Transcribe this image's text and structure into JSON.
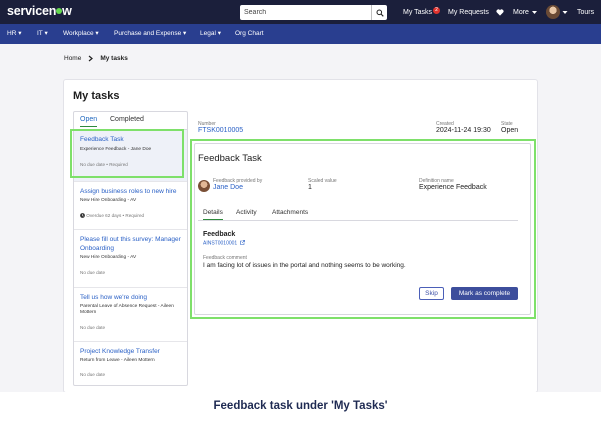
{
  "header": {
    "logo": "servicenow",
    "search_placeholder": "Search",
    "nav": [
      {
        "label": "My Tasks",
        "badge": "2"
      },
      {
        "label": "My Requests"
      },
      {
        "label": "More"
      },
      {
        "label": "Tours"
      }
    ]
  },
  "menubar": {
    "items": [
      "HR",
      "IT",
      "Workplace",
      "Purchase and Expense",
      "Legal",
      "Org Chart"
    ]
  },
  "breadcrumb": {
    "home": "Home",
    "current": "My tasks"
  },
  "page": {
    "title": "My tasks",
    "list_tabs": [
      "Open",
      "Completed"
    ]
  },
  "tasks": [
    {
      "title": "Feedback Task",
      "subtitle": "Experience Feedback - Jane Doe",
      "meta": "No due date • Required"
    },
    {
      "title": "Assign business roles to new hire",
      "subtitle": "New Hire Onboarding - AV",
      "meta": "Overdue 62 days • Required"
    },
    {
      "title": "Please fill out this survey: Manager Onboarding",
      "subtitle": "New Hire Onboarding - AV",
      "meta": "No due date"
    },
    {
      "title": "Tell us how we're doing",
      "subtitle": "Parental Leave of Absence Request - Aileen Mottern",
      "meta": "No due date"
    },
    {
      "title": "Project Knowledge Transfer",
      "subtitle": "Return from Leave - Aileen Mottern",
      "meta": "No due date"
    }
  ],
  "record": {
    "number_label": "Number",
    "number": "FTSK0010005",
    "created_label": "Created",
    "created": "2024-11-24 19:30",
    "state_label": "State",
    "state": "Open"
  },
  "detail": {
    "title": "Feedback Task",
    "provided_by_label": "Feedback provided by",
    "provided_by": "Jane Doe",
    "scaled_label": "Scaled value",
    "scaled": "1",
    "definition_label": "Definition name",
    "definition": "Experience Feedback",
    "tabs": [
      "Details",
      "Activity",
      "Attachments"
    ],
    "feedback_heading": "Feedback",
    "feedback_ref": "AINST0010001",
    "comment_label": "Feedback comment",
    "comment": "I am facing lot of issues in the portal and nothing seems to be working.",
    "skip_label": "Skip",
    "complete_label": "Mark as complete"
  },
  "caption": "Feedback task under 'My Tasks'",
  "colors": {
    "topbar": "#1b1f3b",
    "menubar": "#293e8f",
    "link": "#2b61c6",
    "highlight": "#7ee06a",
    "primary_button": "#3d4e9c"
  }
}
